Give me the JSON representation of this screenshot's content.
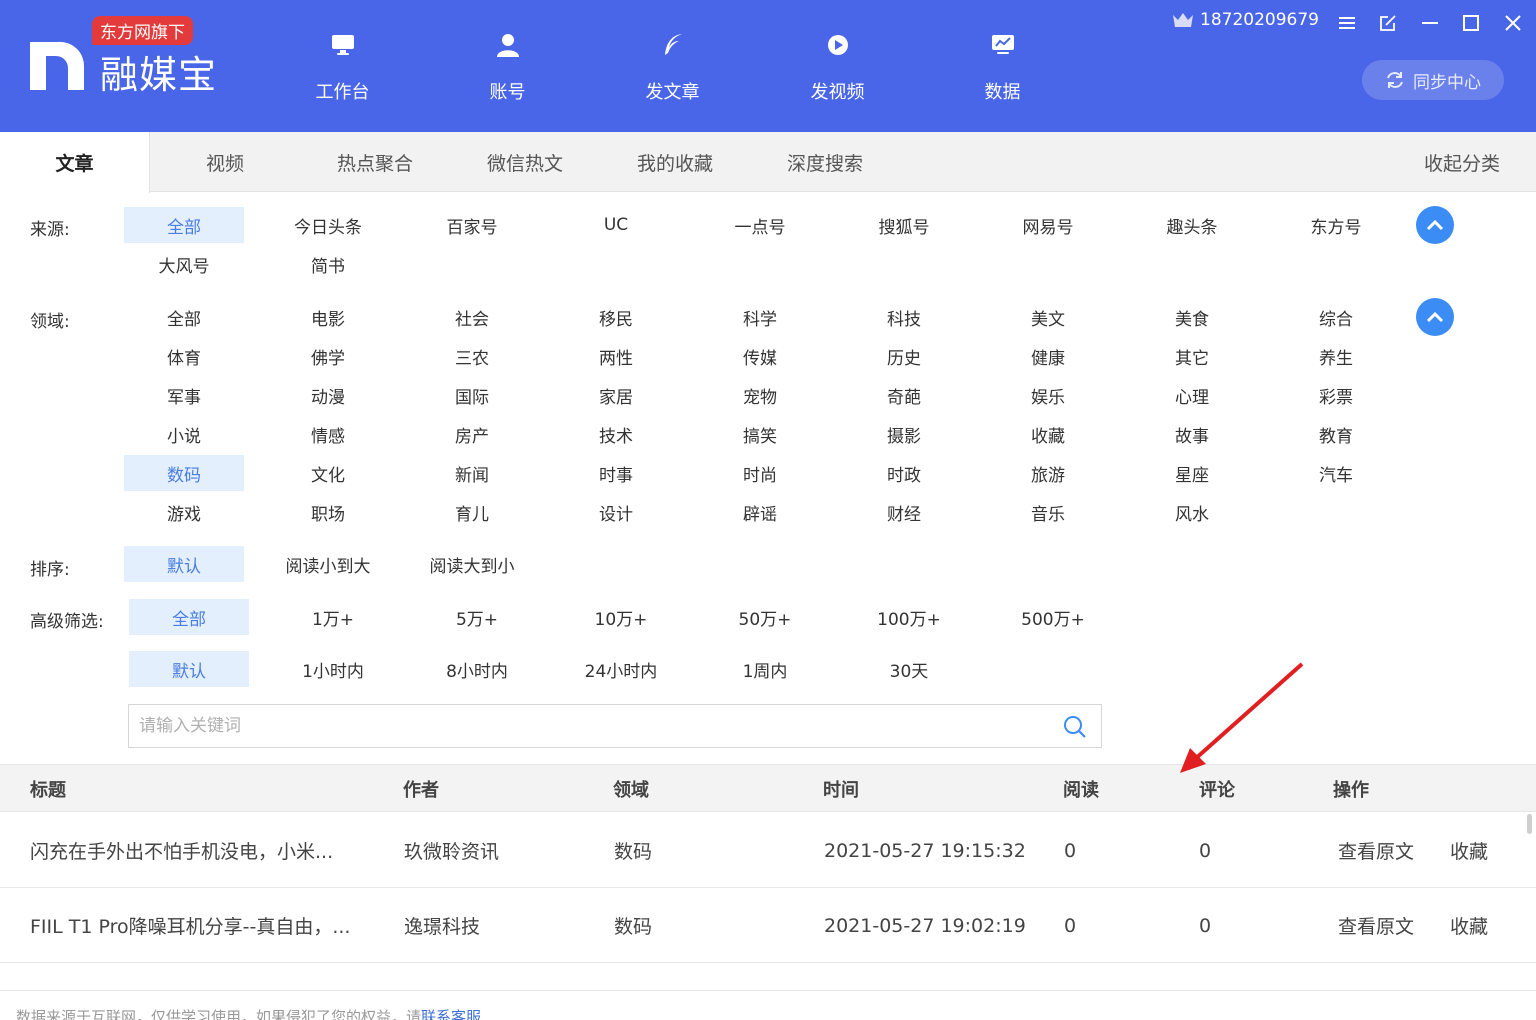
{
  "header": {
    "badge": "东方网旗下",
    "brand": "融媒宝",
    "nav": [
      {
        "label": "工作台",
        "icon": "monitor-icon"
      },
      {
        "label": "账号",
        "icon": "user-icon"
      },
      {
        "label": "发文章",
        "icon": "feather-icon"
      },
      {
        "label": "发视频",
        "icon": "video-icon"
      },
      {
        "label": "数据",
        "icon": "chart-icon"
      }
    ],
    "phone": "18720209679",
    "sync_label": "同步中心"
  },
  "tabs": [
    "文章",
    "视频",
    "热点聚合",
    "微信热文",
    "我的收藏",
    "深度搜索"
  ],
  "collapse_label": "收起分类",
  "filters": {
    "source_label": "来源:",
    "sources": [
      "全部",
      "今日头条",
      "百家号",
      "UC",
      "一点号",
      "搜狐号",
      "网易号",
      "趣头条",
      "东方号",
      "大风号",
      "简书"
    ],
    "domain_label": "领域:",
    "domains": [
      "全部",
      "电影",
      "社会",
      "移民",
      "科学",
      "科技",
      "美文",
      "美食",
      "综合",
      "体育",
      "佛学",
      "三农",
      "两性",
      "传媒",
      "历史",
      "健康",
      "其它",
      "养生",
      "军事",
      "动漫",
      "国际",
      "家居",
      "宠物",
      "奇葩",
      "娱乐",
      "心理",
      "彩票",
      "小说",
      "情感",
      "房产",
      "技术",
      "搞笑",
      "摄影",
      "收藏",
      "故事",
      "教育",
      "数码",
      "文化",
      "新闻",
      "时事",
      "时尚",
      "时政",
      "旅游",
      "星座",
      "汽车",
      "游戏",
      "职场",
      "育儿",
      "设计",
      "辟谣",
      "财经",
      "音乐",
      "风水"
    ],
    "sort_label": "排序:",
    "sorts": [
      "默认",
      "阅读小到大",
      "阅读大到小"
    ],
    "adv_label": "高级筛选:",
    "reads": [
      "全部",
      "1万+",
      "5万+",
      "10万+",
      "50万+",
      "100万+",
      "500万+"
    ],
    "times": [
      "默认",
      "1小时内",
      "8小时内",
      "24小时内",
      "1周内",
      "30天"
    ]
  },
  "search": {
    "placeholder": "请输入关键词"
  },
  "table": {
    "headers": [
      "标题",
      "作者",
      "领域",
      "时间",
      "阅读",
      "评论",
      "操作"
    ],
    "rows": [
      {
        "title": "闪充在手外出不怕手机没电，小米...",
        "author": "玖微聆资讯",
        "domain": "数码",
        "time": "2021-05-27 19:15:32",
        "reads": "0",
        "comments": "0",
        "view": "查看原文",
        "fav": "收藏"
      },
      {
        "title": "FIIL T1 Pro降噪耳机分享--真自由，...",
        "author": "逸璟科技",
        "domain": "数码",
        "time": "2021-05-27 19:02:19",
        "reads": "0",
        "comments": "0",
        "view": "查看原文",
        "fav": "收藏"
      }
    ]
  },
  "footer": {
    "text": "数据来源于互联网，仅供学习使用，如果侵犯了您的权益，请",
    "contact": "联系客服"
  },
  "colors": {
    "brand": "#4a66e8",
    "selected_bg": "#e3effd",
    "selected_text": "#4a7de0",
    "accent_circle": "#3b8cf5",
    "annotation_arrow": "#e02020"
  }
}
